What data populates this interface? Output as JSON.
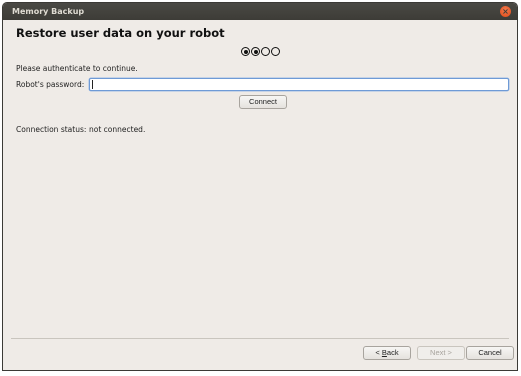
{
  "window": {
    "title": "Memory Backup",
    "close_glyph": "×"
  },
  "page": {
    "title": "Restore user data on your robot",
    "steps": [
      {
        "state": "done"
      },
      {
        "state": "current"
      },
      {
        "state": "todo"
      },
      {
        "state": "todo"
      }
    ]
  },
  "auth": {
    "prompt": "Please authenticate to continue.",
    "password_label": "Robot's password:",
    "password_value": "",
    "connect_label": "Connect"
  },
  "status": {
    "label": "Connection status:",
    "value": "not connected."
  },
  "footer": {
    "back_prefix": "< ",
    "back_mnemonic": "B",
    "back_rest": "ack",
    "next_label": "Next >",
    "cancel_label": "Cancel"
  },
  "colors": {
    "titlebar": "#3d3c37",
    "window_bg": "#efebe7",
    "close_button": "#df4a16",
    "focus_border": "#6e9ad6"
  }
}
